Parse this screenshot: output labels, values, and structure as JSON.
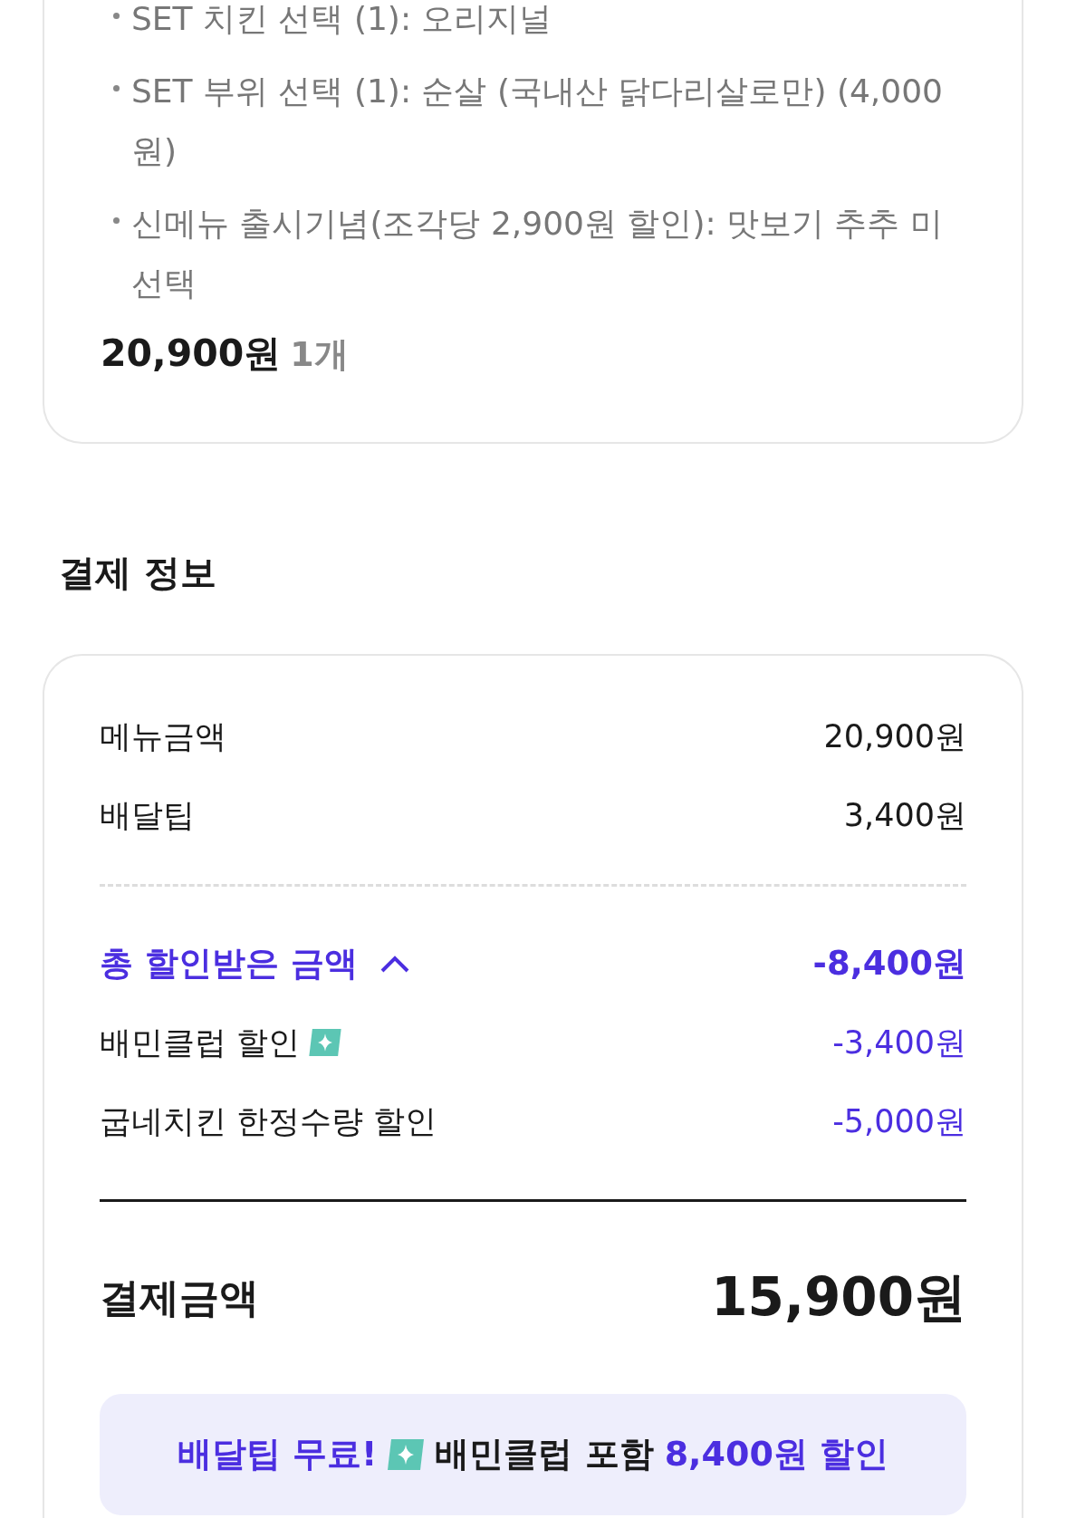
{
  "order_card": {
    "options": [
      "SET 치킨 선택 (1): 오리지널",
      "SET 부위 선택 (1): 순살 (국내산 닭다리살로만) (4,000원)",
      "신메뉴 출시기념(조각당 2,900원 할인): 맛보기 추추 미선택"
    ],
    "price": "20,900원",
    "quantity": "1개"
  },
  "payment": {
    "title": "결제 정보",
    "rows": [
      {
        "label": "메뉴금액",
        "value": "20,900원"
      },
      {
        "label": "배달팁",
        "value": "3,400원"
      }
    ],
    "discount": {
      "label": "총 할인받은 금액",
      "expanded": true,
      "value": "-8,400원",
      "items": [
        {
          "label": "배민클럽 할인",
          "kind": "club",
          "value": "-3,400원"
        },
        {
          "label": "굽네치킨 한정수량 할인",
          "kind": "plain",
          "value": "-5,000원"
        }
      ]
    },
    "total": {
      "label": "결제금액",
      "value": "15,900원"
    },
    "promo": {
      "headline": "배달팁 무료!",
      "text": "배민클럽 포함",
      "amount": "8,400원 할인"
    }
  }
}
